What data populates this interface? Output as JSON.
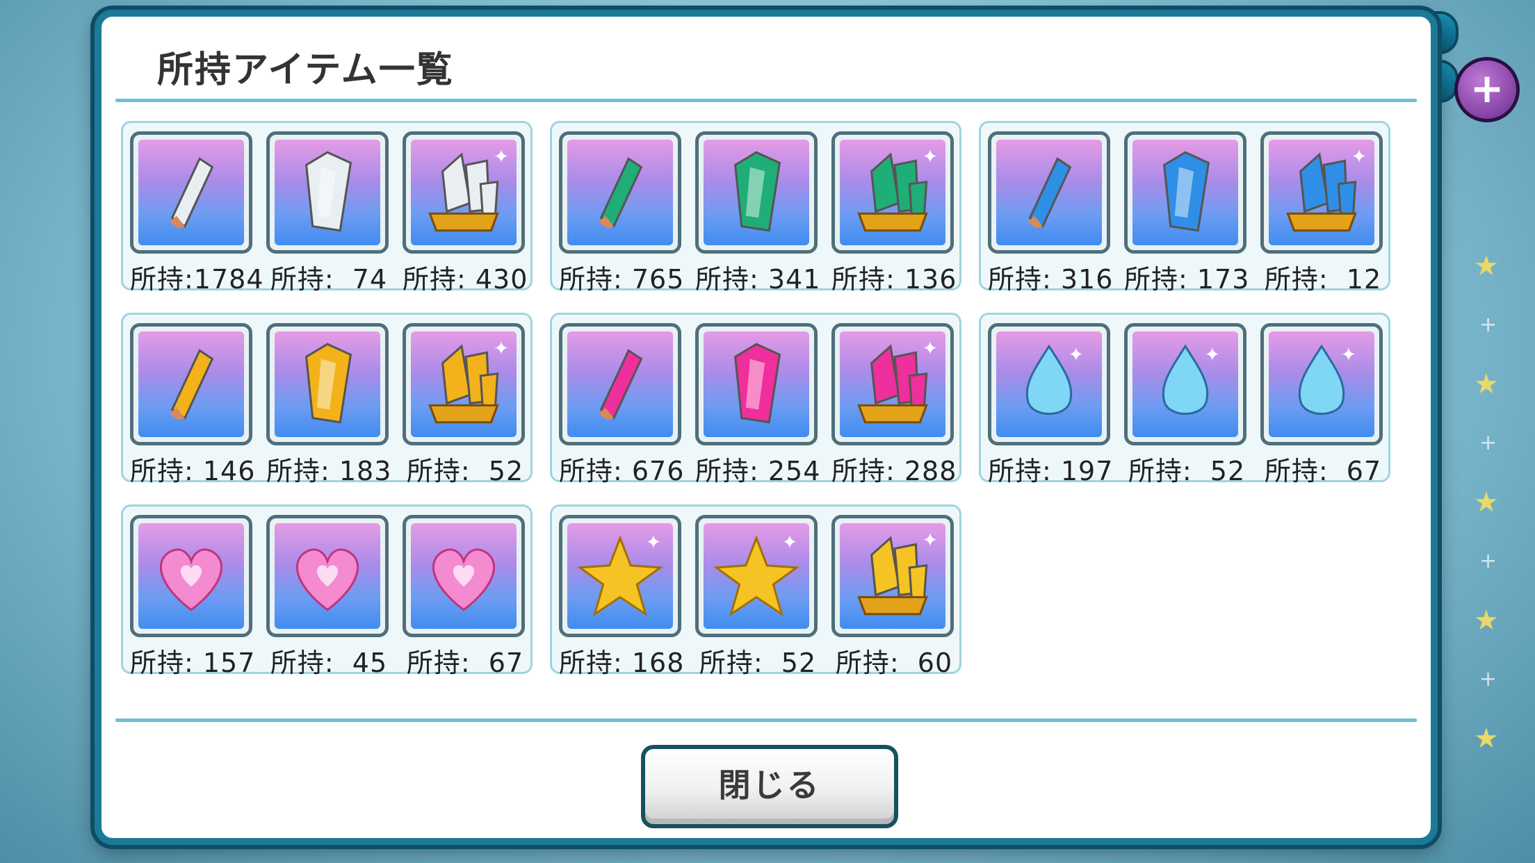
{
  "dialog": {
    "title": "所持アイテム一覧",
    "close_label": "閉じる"
  },
  "hud": {
    "plus_icon": "+"
  },
  "groups": [
    {
      "items": [
        {
          "icon": "white-shard-icon",
          "count": "所持:1784",
          "color": "#e9eef3"
        },
        {
          "icon": "white-crystal-icon",
          "count": "所持:  74",
          "color": "#e9eef3"
        },
        {
          "icon": "white-cluster-icon",
          "count": "所持: 430",
          "color": "#e9eef3"
        }
      ]
    },
    {
      "items": [
        {
          "icon": "green-shard-icon",
          "count": "所持: 765",
          "color": "#1fae78"
        },
        {
          "icon": "green-crystal-icon",
          "count": "所持: 341",
          "color": "#1fae78"
        },
        {
          "icon": "green-cluster-icon",
          "count": "所持: 136",
          "color": "#1fae78"
        }
      ]
    },
    {
      "items": [
        {
          "icon": "blue-shard-icon",
          "count": "所持: 316",
          "color": "#2f8fe6"
        },
        {
          "icon": "blue-crystal-icon",
          "count": "所持: 173",
          "color": "#2f8fe6"
        },
        {
          "icon": "blue-cluster-icon",
          "count": "所持:  12",
          "color": "#2f8fe6"
        }
      ]
    },
    {
      "items": [
        {
          "icon": "yellow-shard-icon",
          "count": "所持: 146",
          "color": "#f3b21a"
        },
        {
          "icon": "yellow-crystal-icon",
          "count": "所持: 183",
          "color": "#f3b21a"
        },
        {
          "icon": "yellow-cluster-icon",
          "count": "所持:  52",
          "color": "#f3b21a"
        }
      ]
    },
    {
      "items": [
        {
          "icon": "pink-shard-icon",
          "count": "所持: 676",
          "color": "#ee2f9c"
        },
        {
          "icon": "pink-crystal-icon",
          "count": "所持: 254",
          "color": "#ee2f9c"
        },
        {
          "icon": "pink-cluster-icon",
          "count": "所持: 288",
          "color": "#ee2f9c"
        }
      ]
    },
    {
      "items": [
        {
          "icon": "water-drop-icon",
          "count": "所持: 197",
          "color": "#7fd6f5"
        },
        {
          "icon": "water-swirl-icon",
          "count": "所持:  52",
          "color": "#7fd6f5"
        },
        {
          "icon": "water-flame-icon",
          "count": "所持:  67",
          "color": "#7fd6f5"
        }
      ]
    },
    {
      "items": [
        {
          "icon": "heart-drop-icon",
          "count": "所持: 157",
          "color": "#f48ad0"
        },
        {
          "icon": "heart-gem-icon",
          "count": "所持:  45",
          "color": "#f48ad0"
        },
        {
          "icon": "winged-heart-icon",
          "count": "所持:  67",
          "color": "#f48ad0"
        }
      ]
    },
    {
      "items": [
        {
          "icon": "star-drop-icon",
          "count": "所持: 168",
          "color": "#f6c324"
        },
        {
          "icon": "sparkle-star-icon",
          "count": "所持:  52",
          "color": "#f6c324"
        },
        {
          "icon": "star-cluster-icon",
          "count": "所持:  60",
          "color": "#f6c324"
        }
      ]
    }
  ]
}
